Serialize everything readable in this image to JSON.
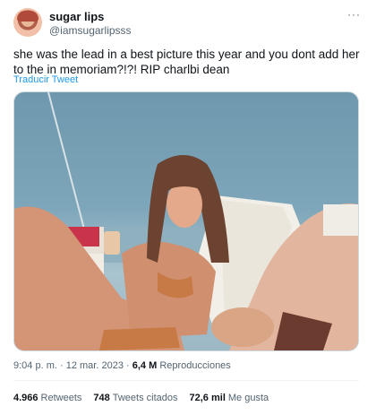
{
  "user": {
    "display_name": "sugar lips",
    "handle": "@iamsugarlipsss"
  },
  "tweet": {
    "text": "she was the lead in a best picture this year and you dont add her to the in memoriam?!?! RIP charlbi dean",
    "translate_label": "Traducir Tweet"
  },
  "menu": {
    "more_label": "···"
  },
  "meta": {
    "time": "9:04 p. m.",
    "separator": "·",
    "date": "12 mar. 2023",
    "views_count": "6,4 M",
    "views_label": "Reproducciones"
  },
  "stats": {
    "retweets_count": "4.966",
    "retweets_label": "Retweets",
    "quotes_count": "748",
    "quotes_label": "Tweets citados",
    "likes_count": "72,6 mil",
    "likes_label": "Me gusta"
  }
}
